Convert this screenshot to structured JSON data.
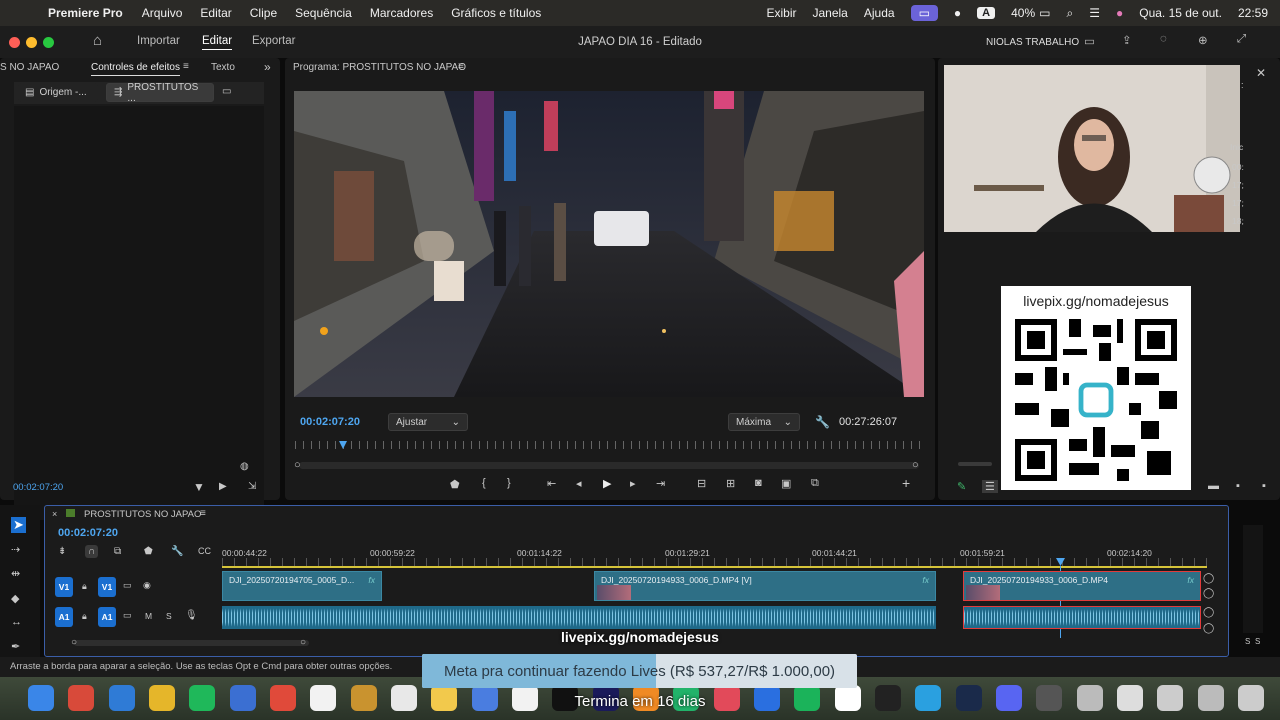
{
  "menubar": {
    "app_name": "Premiere Pro",
    "items": [
      "Arquivo",
      "Editar",
      "Clipe",
      "Sequência",
      "Marcadores",
      "Gráficos e títulos"
    ],
    "right_items": [
      "Exibir",
      "Janela",
      "Ajuda"
    ],
    "battery": "40%",
    "date": "Qua. 15 de out.",
    "time": "22:59",
    "input_letter": "A"
  },
  "titlebar": {
    "nav": [
      "Importar",
      "Editar",
      "Exportar"
    ],
    "active_nav": "Editar",
    "title": "JAPAO DIA 16 - Editado",
    "workspace": "NIOLAS TRABALHO"
  },
  "left_panel": {
    "tabs": [
      "S NO JAPAO",
      "Controles de efeitos",
      "Texto"
    ],
    "source_label": "Origem -...",
    "sequence_label": "PROSTITUTOS ...",
    "timecode": "00:02:07:20"
  },
  "program": {
    "header": "Programa: PROSTITUTOS NO JAPAO",
    "timecode_current": "00:02:07:20",
    "fit_label": "Ajustar",
    "quality_label": "Máxima",
    "timecode_duration": "00:27:26:07"
  },
  "right_panel": {
    "overlay_url": "livepix.gg/nomadejesus",
    "side_labels": [
      "Inic",
      "00:",
      "17;",
      "17;",
      "18;"
    ]
  },
  "timeline": {
    "sequence_name": "PROSTITUTOS NO JAPAO",
    "timecode": "00:02:07:20",
    "ruler": [
      "00:00:44:22",
      "00:00:59:22",
      "00:01:14:22",
      "00:01:29:21",
      "00:01:44:21",
      "00:01:59:21",
      "00:02:14:20"
    ],
    "tracks": {
      "v1": "V1",
      "a1": "A1",
      "m": "M",
      "s": "S"
    },
    "clips": [
      {
        "name": "DJI_20250720194705_0005_D..."
      },
      {
        "name": "DJI_20250720194933_0006_D.MP4 [V]"
      },
      {
        "name": "DJI_20250720194933_0006_D.MP4"
      }
    ],
    "overlay_text": "livepix.gg/nomadejesus"
  },
  "status": {
    "hint": "Arraste a borda para aparar a seleção. Use as teclas Opt e Cmd para obter outras opções."
  },
  "stream_overlay": {
    "goal_text": "Meta pra continuar fazendo Lives (R$ 537,27/R$ 1.000,00)",
    "goal_progress": 0.537,
    "ending_text": "Termina em 16 dias"
  },
  "meters": {
    "labels": [
      "S",
      "S"
    ]
  },
  "colors": {
    "accent": "#4ea6f0",
    "track_blue": "#1b6fd0",
    "clip": "#2e6f86",
    "menu_highlight": "#6b63d8"
  }
}
